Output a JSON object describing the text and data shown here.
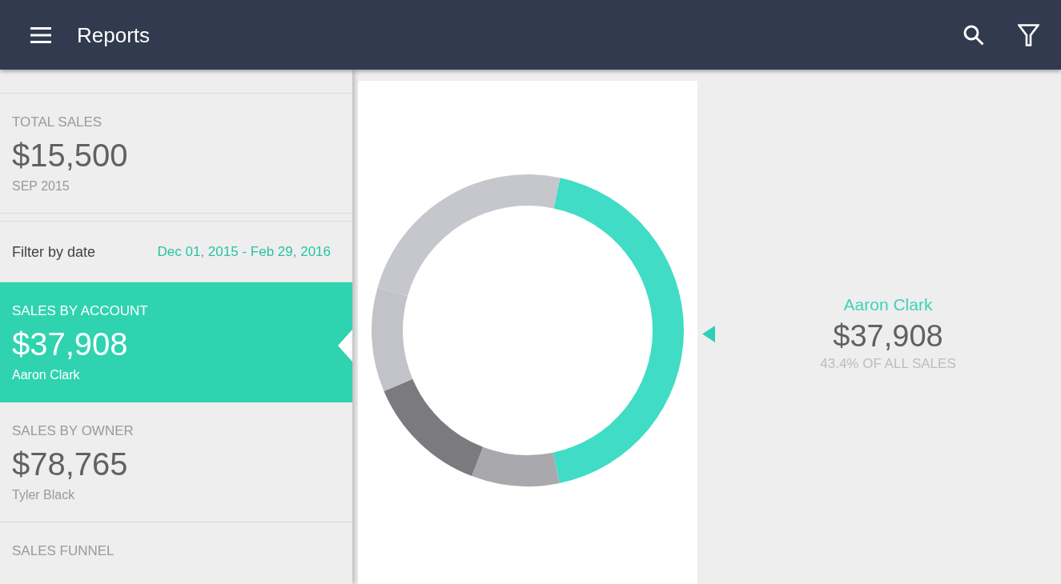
{
  "app_bar": {
    "title": "Reports"
  },
  "sidebar": {
    "cards": [
      {
        "kind": "metric",
        "label": "TOTAL SALES",
        "value": "$15,500",
        "caption": "SEP 2015",
        "selected": false
      },
      {
        "kind": "filter",
        "label": "Filter by date",
        "value": "Dec 01, 2015 - Feb 29, 2016",
        "selected": false
      },
      {
        "kind": "metric",
        "label": "SALES BY ACCOUNT",
        "value": "$37,908",
        "caption": "Aaron Clark",
        "selected": true
      },
      {
        "kind": "metric",
        "label": "SALES BY OWNER",
        "value": "$78,765",
        "caption": "Tyler Black",
        "selected": false
      },
      {
        "kind": "metric",
        "label": "SALES FUNNEL",
        "selected": false
      }
    ]
  },
  "chart_panel": {
    "chart_data": {
      "type": "donut",
      "values": [
        43.4,
        9.1,
        12.8,
        10.8,
        23.9
      ],
      "colors": [
        "#40dcc5",
        "#a9a9ad",
        "#7b7a7e",
        "#c2c2c9",
        "#c6c6cd"
      ]
    }
  },
  "detail": {
    "name": "Aaron Clark",
    "amount": "$37,908",
    "share": "43.4% OF ALL SALES"
  }
}
